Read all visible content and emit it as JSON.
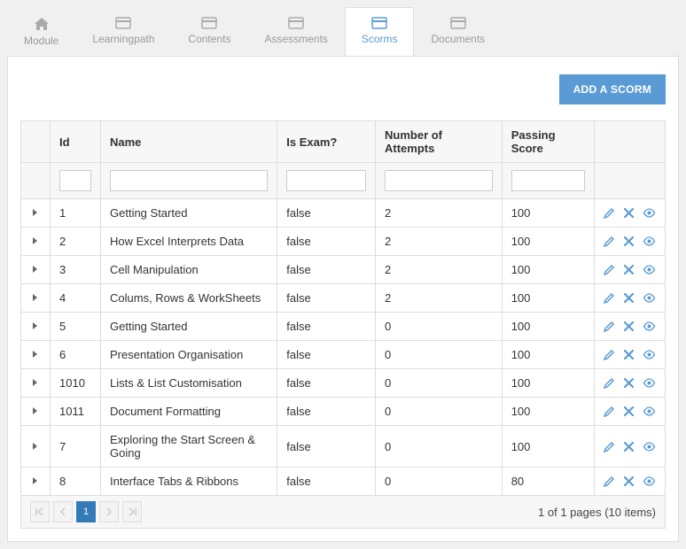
{
  "colors": {
    "accent": "#5b9bd5",
    "primary_btn": "#5b9bd5",
    "pager_current": "#337ab7"
  },
  "tabs": [
    {
      "label": "Module",
      "icon": "home-icon",
      "active": false
    },
    {
      "label": "Learningpath",
      "icon": "card-icon",
      "active": false
    },
    {
      "label": "Contents",
      "icon": "card-icon",
      "active": false
    },
    {
      "label": "Assessments",
      "icon": "card-icon",
      "active": false
    },
    {
      "label": "Scorms",
      "icon": "card-icon",
      "active": true
    },
    {
      "label": "Documents",
      "icon": "card-icon",
      "active": false
    }
  ],
  "toolbar": {
    "add_label": "ADD A SCORM"
  },
  "columns": {
    "id": "Id",
    "name": "Name",
    "is_exam": "Is Exam?",
    "attempts": "Number of Attempts",
    "score": "Passing Score"
  },
  "filters": {
    "id": "",
    "name": "",
    "is_exam": "",
    "attempts": "",
    "score": ""
  },
  "rows": [
    {
      "id": "1",
      "name": "Getting Started",
      "is_exam": "false",
      "attempts": "2",
      "score": "100"
    },
    {
      "id": "2",
      "name": "How Excel Interprets Data",
      "is_exam": "false",
      "attempts": "2",
      "score": "100"
    },
    {
      "id": "3",
      "name": "Cell Manipulation",
      "is_exam": "false",
      "attempts": "2",
      "score": "100"
    },
    {
      "id": "4",
      "name": "Colums, Rows & WorkSheets",
      "is_exam": "false",
      "attempts": "2",
      "score": "100"
    },
    {
      "id": "5",
      "name": "Getting Started",
      "is_exam": "false",
      "attempts": "0",
      "score": "100"
    },
    {
      "id": "6",
      "name": "Presentation Organisation",
      "is_exam": "false",
      "attempts": "0",
      "score": "100"
    },
    {
      "id": "1010",
      "name": "Lists & List Customisation",
      "is_exam": "false",
      "attempts": "0",
      "score": "100"
    },
    {
      "id": "1011",
      "name": "Document Formatting",
      "is_exam": "false",
      "attempts": "0",
      "score": "100"
    },
    {
      "id": "7",
      "name": "Exploring the Start Screen & Going",
      "is_exam": "false",
      "attempts": "0",
      "score": "100"
    },
    {
      "id": "8",
      "name": "Interface Tabs & Ribbons",
      "is_exam": "false",
      "attempts": "0",
      "score": "80"
    }
  ],
  "pager": {
    "current": "1",
    "info": "1 of 1 pages (10 items)"
  }
}
